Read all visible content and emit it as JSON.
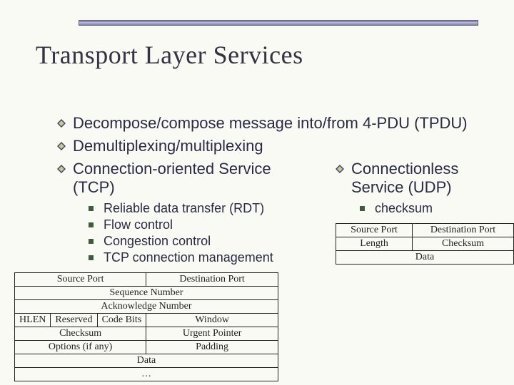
{
  "title": "Transport Layer Services",
  "bullets": {
    "b1": "Decompose/compose message into/from 4-PDU (TPDU)",
    "b2": "Demultiplexing/multiplexing",
    "b3": "Connection-oriented Service (TCP)",
    "b4": "Connectionless Service (UDP)"
  },
  "tcp_subs": {
    "s1": "Reliable data transfer (RDT)",
    "s2": "Flow control",
    "s3": "Congestion control",
    "s4": "TCP connection management"
  },
  "udp_subs": {
    "s1": "checksum"
  },
  "tcp_header": {
    "r1c1": "Source Port",
    "r1c2": "Destination Port",
    "r2": "Sequence Number",
    "r3": "Acknowledge Number",
    "r4c1": "HLEN",
    "r4c2": "Reserved",
    "r4c3": "Code Bits",
    "r4c4": "Window",
    "r5c1": "Checksum",
    "r5c2": "Urgent Pointer",
    "r6c1": "Options (if any)",
    "r6c2": "Padding",
    "r7": "Data",
    "r8": "…"
  },
  "udp_header": {
    "r1c1": "Source Port",
    "r1c2": "Destination Port",
    "r2c1": "Length",
    "r2c2": "Checksum",
    "r3": "Data"
  }
}
